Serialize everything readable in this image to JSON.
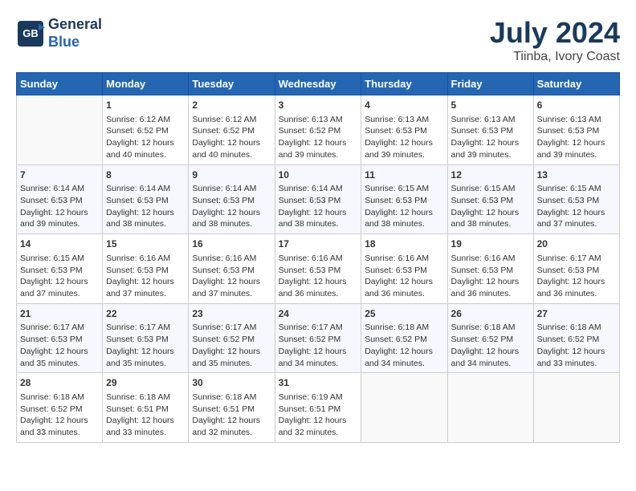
{
  "header": {
    "logo_line1": "General",
    "logo_line2": "Blue",
    "month_year": "July 2024",
    "location": "Tiinba, Ivory Coast"
  },
  "days_of_week": [
    "Sunday",
    "Monday",
    "Tuesday",
    "Wednesday",
    "Thursday",
    "Friday",
    "Saturday"
  ],
  "weeks": [
    [
      {
        "day": "",
        "info": ""
      },
      {
        "day": "1",
        "info": "Sunrise: 6:12 AM\nSunset: 6:52 PM\nDaylight: 12 hours\nand 40 minutes."
      },
      {
        "day": "2",
        "info": "Sunrise: 6:12 AM\nSunset: 6:52 PM\nDaylight: 12 hours\nand 40 minutes."
      },
      {
        "day": "3",
        "info": "Sunrise: 6:13 AM\nSunset: 6:52 PM\nDaylight: 12 hours\nand 39 minutes."
      },
      {
        "day": "4",
        "info": "Sunrise: 6:13 AM\nSunset: 6:53 PM\nDaylight: 12 hours\nand 39 minutes."
      },
      {
        "day": "5",
        "info": "Sunrise: 6:13 AM\nSunset: 6:53 PM\nDaylight: 12 hours\nand 39 minutes."
      },
      {
        "day": "6",
        "info": "Sunrise: 6:13 AM\nSunset: 6:53 PM\nDaylight: 12 hours\nand 39 minutes."
      }
    ],
    [
      {
        "day": "7",
        "info": "Sunrise: 6:14 AM\nSunset: 6:53 PM\nDaylight: 12 hours\nand 39 minutes."
      },
      {
        "day": "8",
        "info": "Sunrise: 6:14 AM\nSunset: 6:53 PM\nDaylight: 12 hours\nand 38 minutes."
      },
      {
        "day": "9",
        "info": "Sunrise: 6:14 AM\nSunset: 6:53 PM\nDaylight: 12 hours\nand 38 minutes."
      },
      {
        "day": "10",
        "info": "Sunrise: 6:14 AM\nSunset: 6:53 PM\nDaylight: 12 hours\nand 38 minutes."
      },
      {
        "day": "11",
        "info": "Sunrise: 6:15 AM\nSunset: 6:53 PM\nDaylight: 12 hours\nand 38 minutes."
      },
      {
        "day": "12",
        "info": "Sunrise: 6:15 AM\nSunset: 6:53 PM\nDaylight: 12 hours\nand 38 minutes."
      },
      {
        "day": "13",
        "info": "Sunrise: 6:15 AM\nSunset: 6:53 PM\nDaylight: 12 hours\nand 37 minutes."
      }
    ],
    [
      {
        "day": "14",
        "info": "Sunrise: 6:15 AM\nSunset: 6:53 PM\nDaylight: 12 hours\nand 37 minutes."
      },
      {
        "day": "15",
        "info": "Sunrise: 6:16 AM\nSunset: 6:53 PM\nDaylight: 12 hours\nand 37 minutes."
      },
      {
        "day": "16",
        "info": "Sunrise: 6:16 AM\nSunset: 6:53 PM\nDaylight: 12 hours\nand 37 minutes."
      },
      {
        "day": "17",
        "info": "Sunrise: 6:16 AM\nSunset: 6:53 PM\nDaylight: 12 hours\nand 36 minutes."
      },
      {
        "day": "18",
        "info": "Sunrise: 6:16 AM\nSunset: 6:53 PM\nDaylight: 12 hours\nand 36 minutes."
      },
      {
        "day": "19",
        "info": "Sunrise: 6:16 AM\nSunset: 6:53 PM\nDaylight: 12 hours\nand 36 minutes."
      },
      {
        "day": "20",
        "info": "Sunrise: 6:17 AM\nSunset: 6:53 PM\nDaylight: 12 hours\nand 36 minutes."
      }
    ],
    [
      {
        "day": "21",
        "info": "Sunrise: 6:17 AM\nSunset: 6:53 PM\nDaylight: 12 hours\nand 35 minutes."
      },
      {
        "day": "22",
        "info": "Sunrise: 6:17 AM\nSunset: 6:53 PM\nDaylight: 12 hours\nand 35 minutes."
      },
      {
        "day": "23",
        "info": "Sunrise: 6:17 AM\nSunset: 6:52 PM\nDaylight: 12 hours\nand 35 minutes."
      },
      {
        "day": "24",
        "info": "Sunrise: 6:17 AM\nSunset: 6:52 PM\nDaylight: 12 hours\nand 34 minutes."
      },
      {
        "day": "25",
        "info": "Sunrise: 6:18 AM\nSunset: 6:52 PM\nDaylight: 12 hours\nand 34 minutes."
      },
      {
        "day": "26",
        "info": "Sunrise: 6:18 AM\nSunset: 6:52 PM\nDaylight: 12 hours\nand 34 minutes."
      },
      {
        "day": "27",
        "info": "Sunrise: 6:18 AM\nSunset: 6:52 PM\nDaylight: 12 hours\nand 33 minutes."
      }
    ],
    [
      {
        "day": "28",
        "info": "Sunrise: 6:18 AM\nSunset: 6:52 PM\nDaylight: 12 hours\nand 33 minutes."
      },
      {
        "day": "29",
        "info": "Sunrise: 6:18 AM\nSunset: 6:51 PM\nDaylight: 12 hours\nand 33 minutes."
      },
      {
        "day": "30",
        "info": "Sunrise: 6:18 AM\nSunset: 6:51 PM\nDaylight: 12 hours\nand 32 minutes."
      },
      {
        "day": "31",
        "info": "Sunrise: 6:19 AM\nSunset: 6:51 PM\nDaylight: 12 hours\nand 32 minutes."
      },
      {
        "day": "",
        "info": ""
      },
      {
        "day": "",
        "info": ""
      },
      {
        "day": "",
        "info": ""
      }
    ]
  ]
}
